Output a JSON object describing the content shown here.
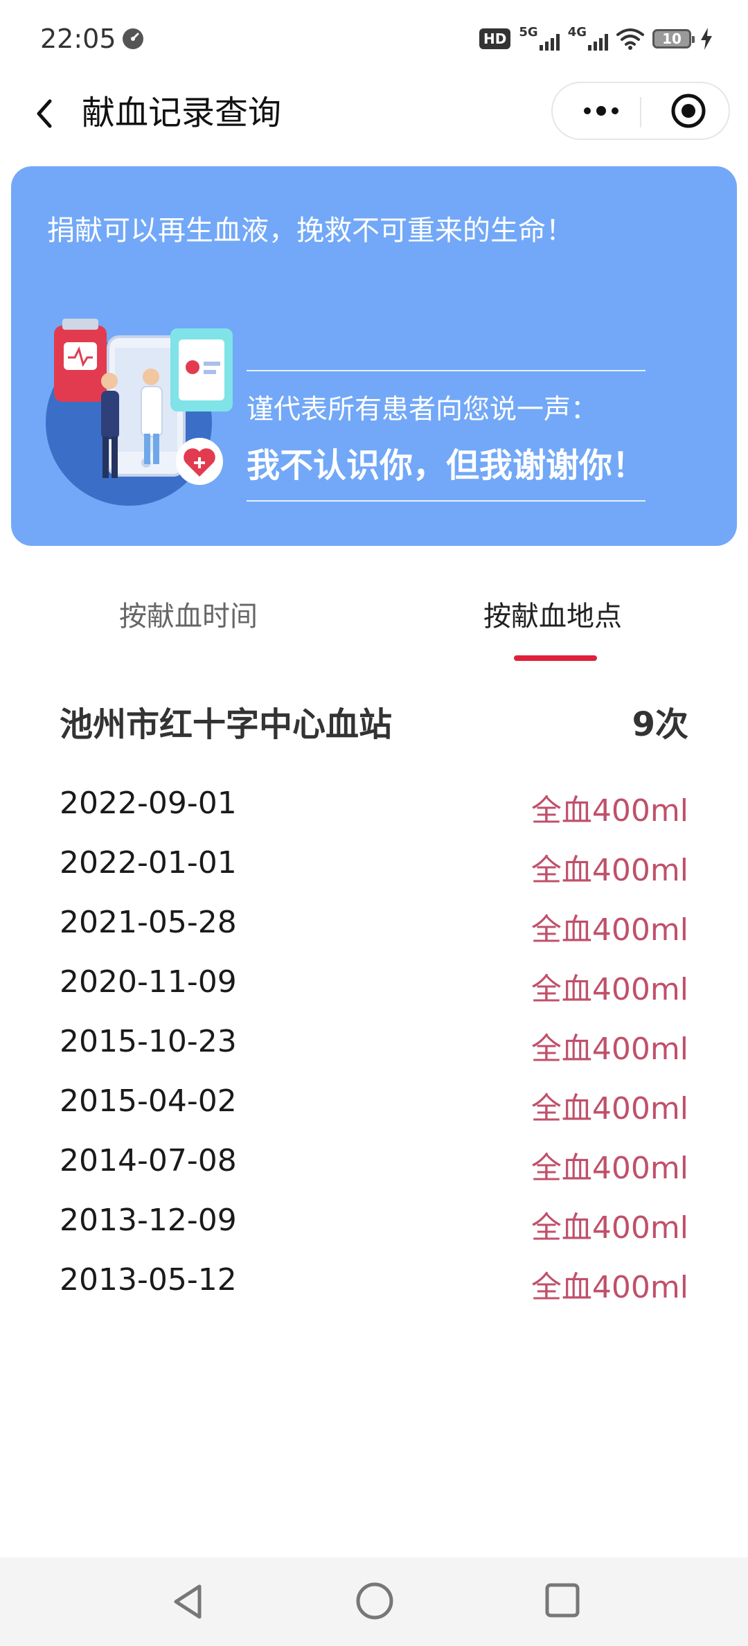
{
  "status_bar": {
    "time": "22:05",
    "hd_label": "HD",
    "network_1": "5G",
    "network_2": "4G",
    "battery": "10"
  },
  "nav": {
    "title": "献血记录查询",
    "back_icon": "chevron-left-icon",
    "more_icon": "more-dots-icon",
    "close_icon": "target-close-icon"
  },
  "banner": {
    "slogan": "捐献可以再生血液，挽救不可重来的生命！",
    "thanks_line1": "谨代表所有患者向您说一声：",
    "thanks_line2": "我不认识你，但我谢谢你！",
    "background_color": "#72a8f7"
  },
  "tabs": [
    {
      "label": "按献血时间",
      "active": false
    },
    {
      "label": "按献血地点",
      "active": true
    }
  ],
  "accent_color": "#e0203a",
  "station": {
    "name": "池州市红十字中心血站",
    "count": "9次"
  },
  "records": [
    {
      "date": "2022-09-01",
      "amount": "全血400ml"
    },
    {
      "date": "2022-01-01",
      "amount": "全血400ml"
    },
    {
      "date": "2021-05-28",
      "amount": "全血400ml"
    },
    {
      "date": "2020-11-09",
      "amount": "全血400ml"
    },
    {
      "date": "2015-10-23",
      "amount": "全血400ml"
    },
    {
      "date": "2015-04-02",
      "amount": "全血400ml"
    },
    {
      "date": "2014-07-08",
      "amount": "全血400ml"
    },
    {
      "date": "2013-12-09",
      "amount": "全血400ml"
    },
    {
      "date": "2013-05-12",
      "amount": "全血400ml"
    }
  ],
  "system_nav": {
    "back_icon": "triangle-back-icon",
    "home_icon": "circle-home-icon",
    "recent_icon": "square-recent-icon"
  }
}
